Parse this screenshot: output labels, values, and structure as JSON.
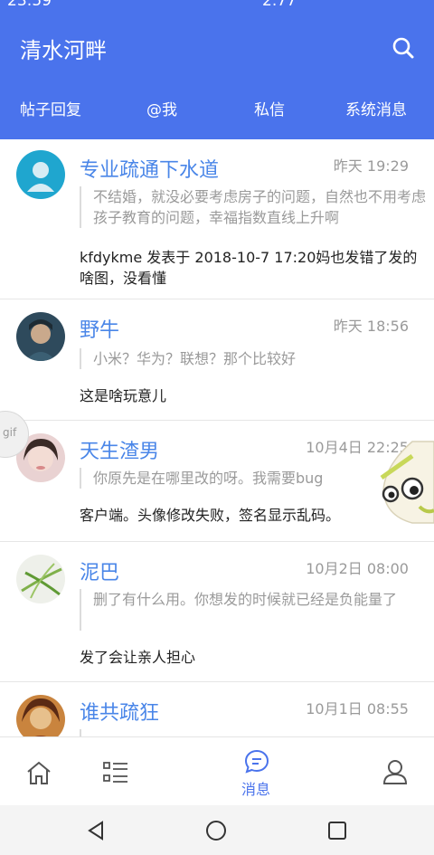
{
  "status_bar": {
    "time": "23:59",
    "speed": "2.77"
  },
  "header": {
    "title": "清水河畔",
    "search_icon": "search-icon",
    "tabs": [
      {
        "label": "帖子回复"
      },
      {
        "label": "@我"
      },
      {
        "label": "私信"
      },
      {
        "label": "系统消息"
      }
    ]
  },
  "messages": [
    {
      "name": "专业疏通下水道",
      "time": "昨天 19:29",
      "quote": "不结婚，就没必要考虑房子的问题，自然也不用考虑孩子教育的问题，幸福指数直线上升啊",
      "body": "kfdykme 发表于 2018-10-7 17:20妈也发错了发的啥图，没看懂"
    },
    {
      "name": "野牛",
      "time": "昨天 18:56",
      "quote": "小米？华为？联想？那个比较好",
      "body": "这是啥玩意儿"
    },
    {
      "name": "天生渣男",
      "time": "10月4日 22:25",
      "quote": "你原先是在哪里改的呀。我需要bug",
      "body": "客户端。头像修改失败，签名显示乱码。"
    },
    {
      "name": "泥巴",
      "time": "10月2日 08:00",
      "quote": "删了有什么用。你想发的时候就已经是负能量了",
      "body": "发了会让亲人担心"
    },
    {
      "name": "谁共疏狂",
      "time": "10月1日 08:55",
      "quote": "",
      "body": ""
    }
  ],
  "gif_badge": "gif",
  "bottom_nav": {
    "items": [
      {
        "icon": "home-icon",
        "label": ""
      },
      {
        "icon": "list-icon",
        "label": ""
      },
      {
        "icon": "message-icon",
        "label": "消息"
      },
      {
        "icon": "profile-icon",
        "label": ""
      }
    ]
  },
  "colors": {
    "primary": "#4a73ec",
    "link": "#4a86e8",
    "muted": "#9a9a9a",
    "text": "#222222"
  }
}
